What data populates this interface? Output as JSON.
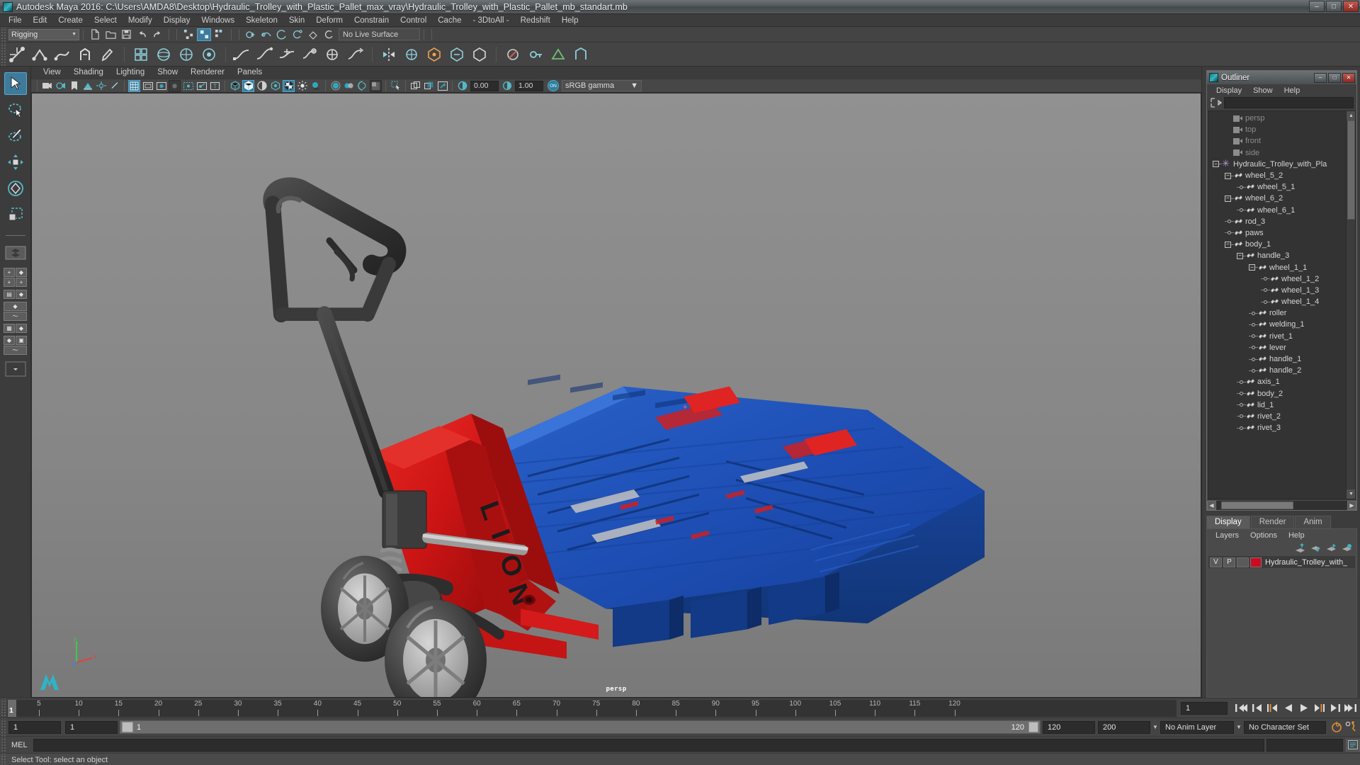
{
  "window": {
    "title": "Autodesk Maya 2016: C:\\Users\\AMDA8\\Desktop\\Hydraulic_Trolley_with_Plastic_Pallet_max_vray\\Hydraulic_Trolley_with_Plastic_Pallet_mb_standart.mb",
    "minimize": "–",
    "maximize": "□",
    "close": "✕"
  },
  "menubar": {
    "items": [
      "File",
      "Edit",
      "Create",
      "Select",
      "Modify",
      "Display",
      "Windows",
      "Skeleton",
      "Skin",
      "Deform",
      "Constrain",
      "Control",
      "Cache",
      "- 3DtoAll -",
      "Redshift",
      "Help"
    ]
  },
  "statusline": {
    "menu_set": "Rigging",
    "live_surface": "No Live Surface"
  },
  "viewport_panel": {
    "menus": [
      "View",
      "Shading",
      "Lighting",
      "Show",
      "Renderer",
      "Panels"
    ],
    "exposure": "0.00",
    "gamma_value": "1.00",
    "color_management": "sRGB gamma",
    "cm_toggle": "ON",
    "camera_label": "persp"
  },
  "outliner": {
    "window_title": "Outliner",
    "menus": [
      "Display",
      "Show",
      "Help"
    ],
    "search_value": "",
    "search_placeholder": "",
    "minimize": "–",
    "maximize": "□",
    "close": "✕",
    "items": [
      {
        "label": "persp",
        "indent": 1,
        "icon": "camera-icon",
        "type": "camera",
        "expander": "none",
        "dot": false
      },
      {
        "label": "top",
        "indent": 1,
        "icon": "camera-icon",
        "type": "camera",
        "expander": "none",
        "dot": false
      },
      {
        "label": "front",
        "indent": 1,
        "icon": "camera-icon",
        "type": "camera",
        "expander": "none",
        "dot": false
      },
      {
        "label": "side",
        "indent": 1,
        "icon": "camera-icon",
        "type": "camera",
        "expander": "none",
        "dot": false
      },
      {
        "label": "Hydraulic_Trolley_with_Pla",
        "indent": 0,
        "icon": "asterisk-icon",
        "type": "group",
        "expander": "minus",
        "dot": false
      },
      {
        "label": "wheel_5_2",
        "indent": 1,
        "icon": "mesh-icon",
        "type": "mesh",
        "expander": "minus",
        "dot": false
      },
      {
        "label": "wheel_5_1",
        "indent": 2,
        "icon": "mesh-icon",
        "type": "mesh",
        "expander": "none",
        "dot": true
      },
      {
        "label": "wheel_6_2",
        "indent": 1,
        "icon": "mesh-icon",
        "type": "mesh",
        "expander": "minus",
        "dot": false
      },
      {
        "label": "wheel_6_1",
        "indent": 2,
        "icon": "mesh-icon",
        "type": "mesh",
        "expander": "none",
        "dot": true
      },
      {
        "label": "rod_3",
        "indent": 1,
        "icon": "mesh-icon",
        "type": "mesh",
        "expander": "none",
        "dot": true
      },
      {
        "label": "paws",
        "indent": 1,
        "icon": "mesh-icon",
        "type": "mesh",
        "expander": "none",
        "dot": true
      },
      {
        "label": "body_1",
        "indent": 1,
        "icon": "mesh-icon",
        "type": "mesh",
        "expander": "minus",
        "dot": false
      },
      {
        "label": "handle_3",
        "indent": 2,
        "icon": "mesh-icon",
        "type": "mesh",
        "expander": "minus",
        "dot": false
      },
      {
        "label": "wheel_1_1",
        "indent": 3,
        "icon": "mesh-icon",
        "type": "mesh",
        "expander": "minus",
        "dot": false
      },
      {
        "label": "wheel_1_2",
        "indent": 4,
        "icon": "mesh-icon",
        "type": "mesh",
        "expander": "none",
        "dot": true
      },
      {
        "label": "wheel_1_3",
        "indent": 4,
        "icon": "mesh-icon",
        "type": "mesh",
        "expander": "none",
        "dot": true
      },
      {
        "label": "wheel_1_4",
        "indent": 4,
        "icon": "mesh-icon",
        "type": "mesh",
        "expander": "none",
        "dot": true
      },
      {
        "label": "roller",
        "indent": 3,
        "icon": "mesh-icon",
        "type": "mesh",
        "expander": "none",
        "dot": true
      },
      {
        "label": "welding_1",
        "indent": 3,
        "icon": "mesh-icon",
        "type": "mesh",
        "expander": "none",
        "dot": true
      },
      {
        "label": "rivet_1",
        "indent": 3,
        "icon": "mesh-icon",
        "type": "mesh",
        "expander": "none",
        "dot": true
      },
      {
        "label": "lever",
        "indent": 3,
        "icon": "mesh-icon",
        "type": "mesh",
        "expander": "none",
        "dot": true
      },
      {
        "label": "handle_1",
        "indent": 3,
        "icon": "mesh-icon",
        "type": "mesh",
        "expander": "none",
        "dot": true
      },
      {
        "label": "handle_2",
        "indent": 3,
        "icon": "mesh-icon",
        "type": "mesh",
        "expander": "none",
        "dot": true
      },
      {
        "label": "axis_1",
        "indent": 2,
        "icon": "mesh-icon",
        "type": "mesh",
        "expander": "none",
        "dot": true
      },
      {
        "label": "body_2",
        "indent": 2,
        "icon": "mesh-icon",
        "type": "mesh",
        "expander": "none",
        "dot": true
      },
      {
        "label": "lid_1",
        "indent": 2,
        "icon": "mesh-icon",
        "type": "mesh",
        "expander": "none",
        "dot": true
      },
      {
        "label": "rivet_2",
        "indent": 2,
        "icon": "mesh-icon",
        "type": "mesh",
        "expander": "none",
        "dot": true
      },
      {
        "label": "rivet_3",
        "indent": 2,
        "icon": "mesh-icon",
        "type": "mesh",
        "expander": "none",
        "dot": true
      }
    ]
  },
  "layer_editor": {
    "tabs": [
      "Display",
      "Render",
      "Anim"
    ],
    "active_tab": "Display",
    "menus": [
      "Layers",
      "Options",
      "Help"
    ],
    "rows": [
      {
        "visibility": "V",
        "playback": "P",
        "state": "",
        "color": "#cc0a22",
        "name": "Hydraulic_Trolley_with_"
      }
    ]
  },
  "timeline": {
    "ticks": [
      5,
      10,
      15,
      20,
      25,
      30,
      35,
      40,
      45,
      50,
      55,
      60,
      65,
      70,
      75,
      80,
      85,
      90,
      95,
      100,
      105,
      110,
      115,
      120
    ],
    "current_frame": "1",
    "current_frame_field": "1",
    "range_start": "1",
    "range_end": "1",
    "playback_start_label": "1",
    "playback_end_label": "120",
    "anim_end": "120",
    "anim_total": "200",
    "anim_layer": "No Anim Layer",
    "character_set": "No Character Set"
  },
  "command_line": {
    "language": "MEL",
    "input_value": "",
    "input_placeholder": ""
  },
  "status": {
    "message": "Select Tool: select an object"
  },
  "colors": {
    "accent_blue": "#3e7a9c",
    "teal": "#35b8c6",
    "orange": "#e08b35",
    "viewport_bg": "#848484",
    "layer_red": "#cc0a22"
  }
}
